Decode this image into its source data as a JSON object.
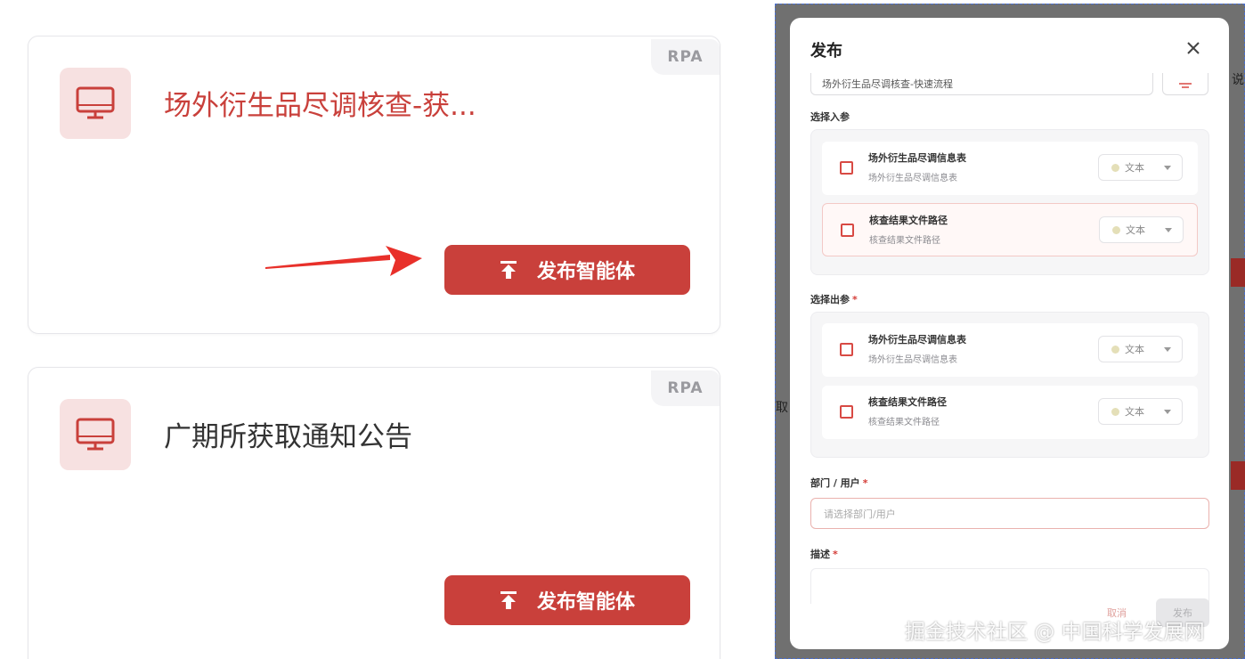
{
  "cards": [
    {
      "badge": "RPA",
      "title": "场外衍生品尽调核查-获...",
      "publish_label": "发布智能体"
    },
    {
      "badge": "RPA",
      "title": "广期所获取通知公告",
      "publish_label": "发布智能体"
    }
  ],
  "side_fragments": {
    "left_text": "取",
    "right_text": "说"
  },
  "dialog": {
    "title": "发布",
    "name_value": "场外衍生品尽调核查-快速流程",
    "input_section": {
      "label": "选择入参",
      "params": [
        {
          "name": "场外衍生品尽调信息表",
          "desc": "场外衍生品尽调信息表",
          "type": "文本"
        },
        {
          "name": "核查结果文件路径",
          "desc": "核查结果文件路径",
          "type": "文本"
        }
      ]
    },
    "output_section": {
      "label": "选择出参",
      "required": "*",
      "params": [
        {
          "name": "场外衍生品尽调信息表",
          "desc": "场外衍生品尽调信息表",
          "type": "文本"
        },
        {
          "name": "核查结果文件路径",
          "desc": "核查结果文件路径",
          "type": "文本"
        }
      ]
    },
    "dept": {
      "label": "部门 / 用户",
      "required": "*",
      "placeholder": "请选择部门/用户"
    },
    "description": {
      "label": "描述",
      "required": "*"
    },
    "cancel_label": "取消",
    "submit_label": "发布"
  },
  "watermark": "掘金技术社区 @ 中国科学发展网",
  "colors": {
    "brand_red": "#c9403b",
    "icon_tile_bg": "#f7e1e1",
    "overlay": "#707070"
  }
}
